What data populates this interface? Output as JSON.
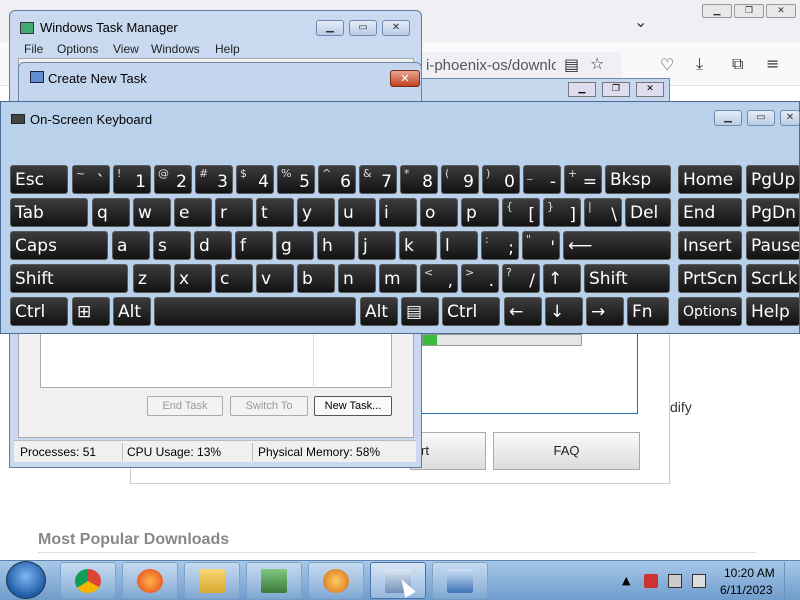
{
  "browser": {
    "url": "i-phoenix-os/downlo",
    "page_modify_text": "dify",
    "page_button_faq": "FAQ",
    "page_button_rt": "rt",
    "popular_heading": "Most Popular Downloads",
    "win_min": "▁",
    "win_max": "❐",
    "win_close": "✕"
  },
  "task_manager": {
    "title": "Windows Task Manager",
    "menu": [
      "File",
      "Options",
      "View",
      "Windows",
      "Help"
    ],
    "buttons": {
      "end_task": "End Task",
      "switch_to": "Switch To",
      "new_task": "New Task..."
    },
    "status": {
      "processes": "Processes: 51",
      "cpu": "CPU Usage: 13%",
      "memory": "Physical Memory: 58%"
    },
    "win_min": "▁",
    "win_max": "▭",
    "win_close": "✕"
  },
  "create_task": {
    "title": "Create New Task",
    "close": "✕"
  },
  "osk": {
    "title": "On-Screen Keyboard",
    "win_min": "▁",
    "win_max": "▭",
    "win_close": "✕",
    "row1": [
      {
        "main": "Esc"
      },
      {
        "sh": "~",
        "lo": "`"
      },
      {
        "sh": "!",
        "lo": "1"
      },
      {
        "sh": "@",
        "lo": "2"
      },
      {
        "sh": "#",
        "lo": "3"
      },
      {
        "sh": "$",
        "lo": "4"
      },
      {
        "sh": "%",
        "lo": "5"
      },
      {
        "sh": "^",
        "lo": "6"
      },
      {
        "sh": "&",
        "lo": "7"
      },
      {
        "sh": "*",
        "lo": "8"
      },
      {
        "sh": "(",
        "lo": "9"
      },
      {
        "sh": ")",
        "lo": "0"
      },
      {
        "sh": "_",
        "lo": "-"
      },
      {
        "sh": "+",
        "lo": "="
      },
      {
        "main": "Bksp"
      },
      {
        "main": "Home"
      },
      {
        "main": "PgUp"
      }
    ],
    "row2": [
      {
        "main": "Tab"
      },
      {
        "main": "q"
      },
      {
        "main": "w"
      },
      {
        "main": "e"
      },
      {
        "main": "r"
      },
      {
        "main": "t"
      },
      {
        "main": "y"
      },
      {
        "main": "u"
      },
      {
        "main": "i"
      },
      {
        "main": "o"
      },
      {
        "main": "p"
      },
      {
        "sh": "{",
        "lo": "["
      },
      {
        "sh": "}",
        "lo": "]"
      },
      {
        "sh": "|",
        "lo": "\\"
      },
      {
        "main": "Del"
      },
      {
        "main": "End"
      },
      {
        "main": "PgDn"
      }
    ],
    "row3": [
      {
        "main": "Caps"
      },
      {
        "main": "a"
      },
      {
        "main": "s"
      },
      {
        "main": "d"
      },
      {
        "main": "f"
      },
      {
        "main": "g"
      },
      {
        "main": "h"
      },
      {
        "main": "j"
      },
      {
        "main": "k"
      },
      {
        "main": "l"
      },
      {
        "sh": ":",
        "lo": ";"
      },
      {
        "sh": "\"",
        "lo": "'"
      },
      {
        "main": "⟵"
      },
      {
        "main": "Insert"
      },
      {
        "main": "Pause"
      }
    ],
    "row4": [
      {
        "main": "Shift"
      },
      {
        "main": "z"
      },
      {
        "main": "x"
      },
      {
        "main": "c"
      },
      {
        "main": "v"
      },
      {
        "main": "b"
      },
      {
        "main": "n"
      },
      {
        "main": "m"
      },
      {
        "sh": "<",
        "lo": ","
      },
      {
        "sh": ">",
        "lo": "."
      },
      {
        "sh": "?",
        "lo": "/"
      },
      {
        "main": "↑"
      },
      {
        "main": "Shift"
      },
      {
        "main": "PrtScn"
      },
      {
        "main": "ScrLk"
      }
    ],
    "row5": [
      {
        "main": "Ctrl"
      },
      {
        "main": "⊞"
      },
      {
        "main": "Alt"
      },
      {
        "main": ""
      },
      {
        "main": "Alt"
      },
      {
        "main": "▤"
      },
      {
        "main": "Ctrl"
      },
      {
        "main": "←"
      },
      {
        "main": "↓"
      },
      {
        "main": "→"
      },
      {
        "main": "Fn"
      },
      {
        "opt": "Options"
      },
      {
        "main": "Help"
      }
    ]
  },
  "taskbar": {
    "time": "10:20 AM",
    "date": "6/11/2023",
    "tray_arrow": "▲"
  }
}
